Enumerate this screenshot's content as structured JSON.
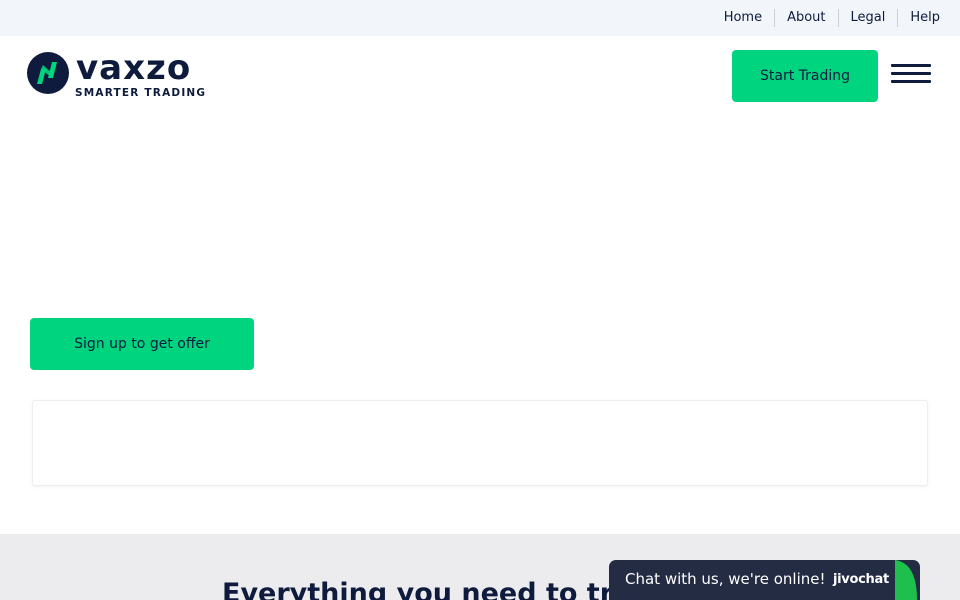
{
  "topnav": {
    "items": [
      {
        "label": "Home"
      },
      {
        "label": "About"
      },
      {
        "label": "Legal"
      },
      {
        "label": "Help"
      }
    ]
  },
  "header": {
    "logo_word": "vaxzo",
    "logo_tagline": "SMARTER TRADING",
    "cta_label": "Start Trading",
    "menu_icon": "hamburger-menu-icon"
  },
  "hero": {
    "signup_label": "Sign up to get offer"
  },
  "section": {
    "heading": "Everything you need to trade"
  },
  "chat": {
    "text": "Chat with us, we're online!",
    "brand": "jivochat"
  },
  "colors": {
    "accent_green": "#00d47e",
    "navy": "#0e1b3d",
    "topbar_bg": "#f2f5f9",
    "section_bg": "#ecebed",
    "chat_bg": "#242c44"
  }
}
